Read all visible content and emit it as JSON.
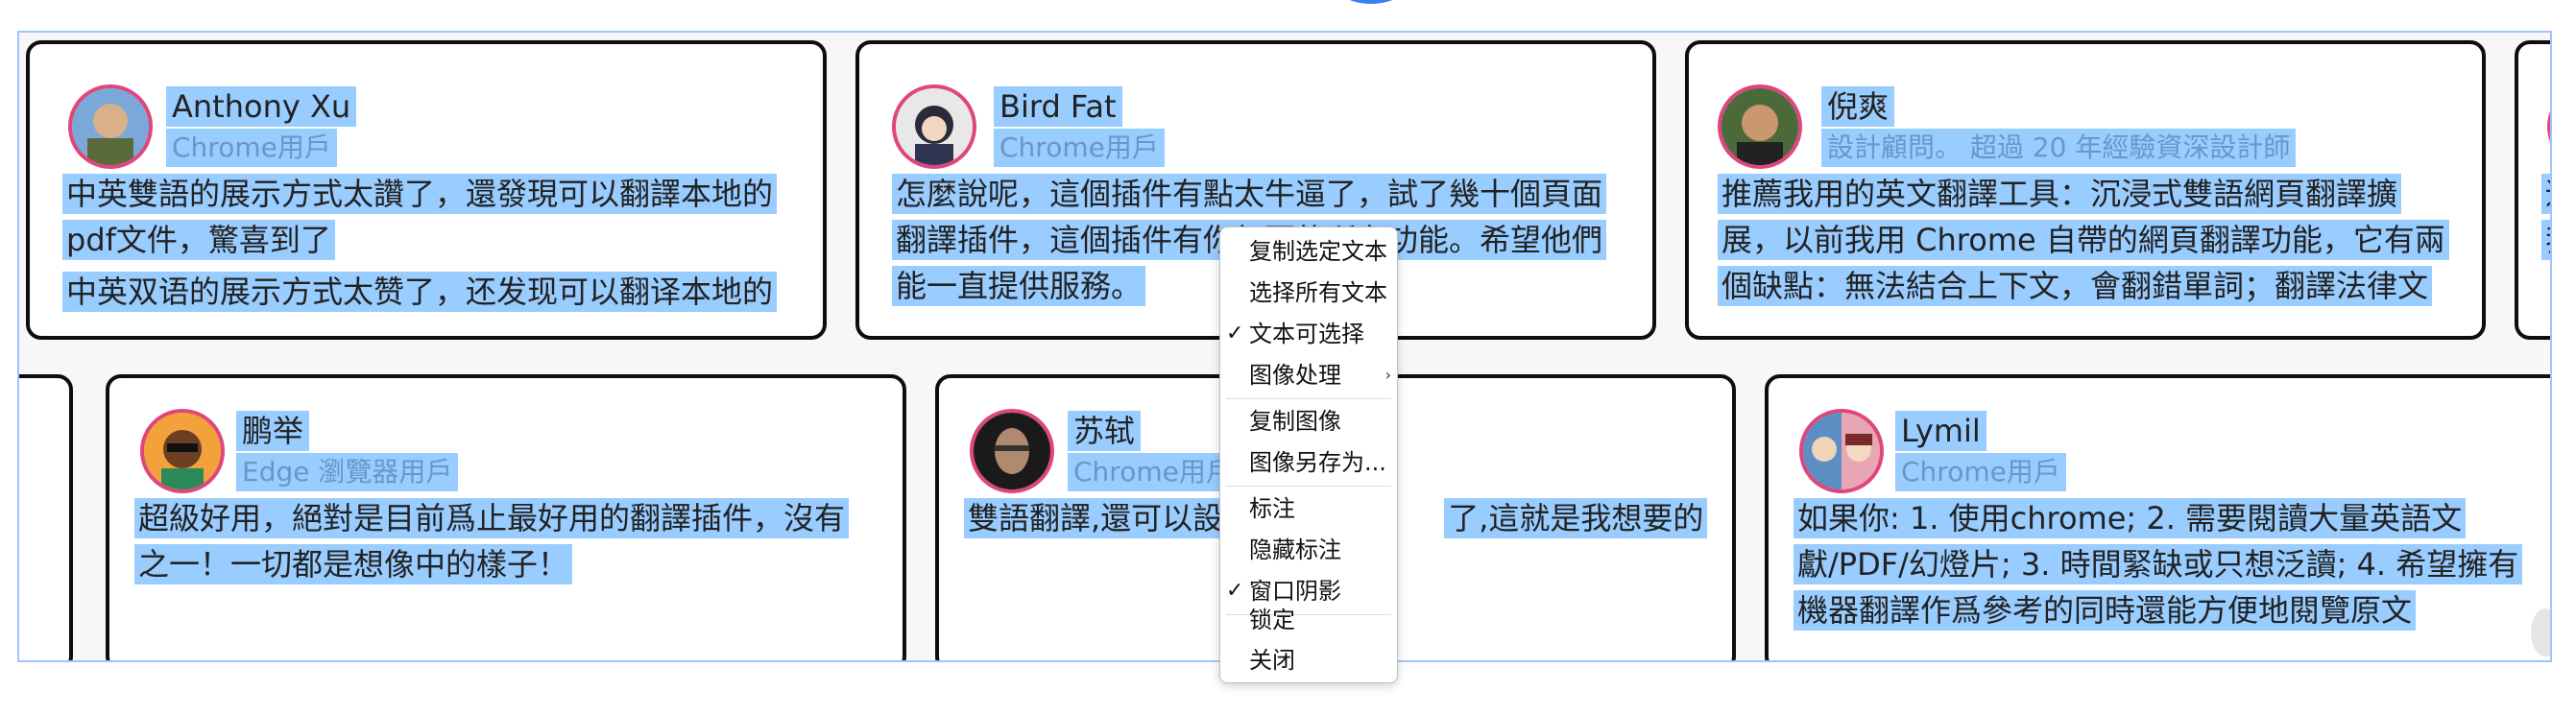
{
  "reviews_top": [
    {
      "name": "Anthony Xu",
      "subtitle": "Chrome用戶",
      "lines": [
        "中英雙語的展示方式太讚了，還發現可以翻譯本地的",
        "pdf文件，驚喜到了",
        "中英双语的展示方式太赞了，还发现可以翻译本地的"
      ]
    },
    {
      "name": "Bird Fat",
      "subtitle": "Chrome用戶",
      "lines": [
        "怎麼說呢，這個插件有點太牛逼了，試了幾十個頁面",
        "翻譯插件，這個插件有你想要的所有功能。希望他們",
        "能一直提供服務。"
      ]
    },
    {
      "name": "倪爽",
      "subtitle": "設計顧問。 超過 20 年經驗資深設計師",
      "lines": [
        "推薦我用的英文翻譯工具：沉浸式雙語網頁翻譯擴",
        "展，以前我用 Chrome 自帶的網頁翻譯功能，它有兩",
        "個缺點：無法結合上下文，會翻錯單詞；翻譯法律文"
      ]
    }
  ],
  "reviews_bottom": [
    {
      "name": "鹏举",
      "subtitle": "Edge 瀏覽器用戶",
      "lines": [
        "超級好用，絕對是目前爲止最好用的翻譯插件，沒有",
        "之一！一切都是想像中的樣子！"
      ]
    },
    {
      "name": "苏轼",
      "subtitle": "Chrome用戶",
      "lines": [
        "雙語翻譯,還可以設",
        "了,這就是我想要的"
      ]
    },
    {
      "name": "Lymil",
      "subtitle": "Chrome用戶",
      "lines": [
        "如果你: 1. 使用chrome; 2. 需要閱讀大量英語文",
        "獻/PDF/幻燈片; 3. 時間緊缺或只想泛讀; 4. 希望擁有",
        "機器翻譯作爲參考的同時還能方便地閱覽原文"
      ]
    }
  ],
  "partial_right_chars": [
    "适",
    "我"
  ],
  "context_menu": {
    "items": [
      {
        "label": "复制选定文本",
        "checked": false,
        "submenu": false
      },
      {
        "label": "选择所有文本",
        "checked": false,
        "submenu": false
      },
      {
        "label": "文本可选择",
        "checked": true,
        "submenu": false
      },
      {
        "label": "图像处理",
        "checked": false,
        "submenu": true
      },
      {
        "label": "复制图像",
        "checked": false,
        "submenu": false
      },
      {
        "label": "图像另存为...",
        "checked": false,
        "submenu": false
      },
      {
        "label": "标注",
        "checked": false,
        "submenu": false
      },
      {
        "label": "隐藏标注",
        "checked": false,
        "submenu": false
      },
      {
        "label": "窗口阴影",
        "checked": true,
        "submenu": false
      },
      {
        "label": "锁定",
        "checked": false,
        "submenu": false
      },
      {
        "label": "关闭",
        "checked": false,
        "submenu": false
      }
    ],
    "check_glyph": "✓",
    "submenu_glyph": "›"
  },
  "colors": {
    "selection": "#99ccff",
    "avatar_ring": "#e0457b",
    "frame_border": "#9ec5ff",
    "subtitle": "#6a96c8",
    "top_dot": "#3b7ef0"
  }
}
